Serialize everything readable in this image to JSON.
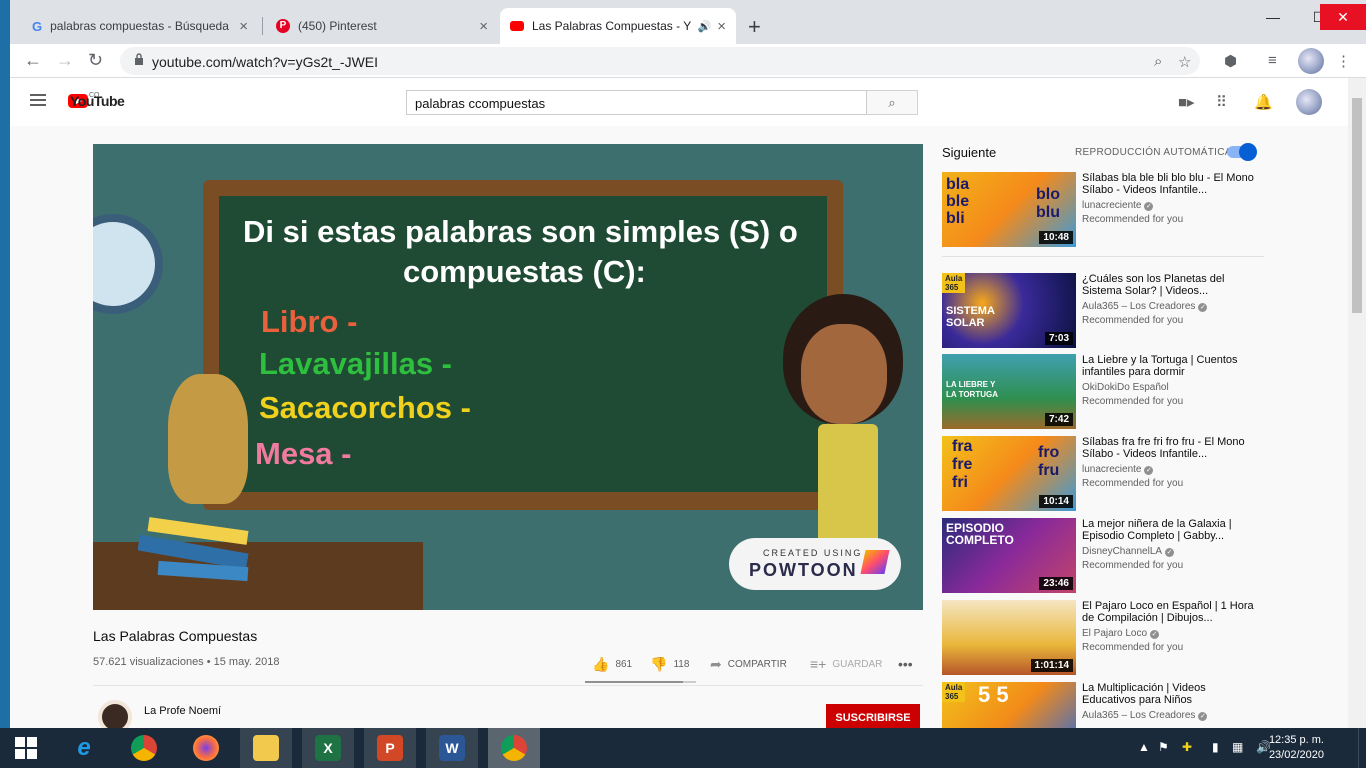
{
  "browser": {
    "tabs": [
      {
        "title": "palabras compuestas - Búsqueda",
        "icon": "google-icon"
      },
      {
        "title": "(450) Pinterest",
        "icon": "pinterest-icon"
      },
      {
        "title": "Las Palabras Compuestas - Y",
        "icon": "youtube-icon"
      }
    ],
    "url": "youtube.com/watch?v=yGs2t_-JWEI"
  },
  "header": {
    "logo_text": "YouTube",
    "region": "CO",
    "search_query": "palabras ccompuestas"
  },
  "video": {
    "slide_question_line1": "Di si estas palabras son simples (S) o",
    "slide_question_line2": "compuestas (C):",
    "slide_words": [
      {
        "text": "Libro -",
        "color": "#e8603c"
      },
      {
        "text": "Lavavajillas -",
        "color": "#2fbf3f"
      },
      {
        "text": "Sacacorchos -",
        "color": "#f0d21e"
      },
      {
        "text": "Mesa -",
        "color": "#f07aa0"
      }
    ],
    "watermark_top": "CREATED USING",
    "watermark_brand": "POWTOON",
    "title": "Las Palabras Compuestas",
    "views": "57.621 visualizaciones • 15 may. 2018",
    "likes": "861",
    "dislikes": "118",
    "like_ratio": 0.88,
    "share_label": "COMPARTIR",
    "save_label": "GUARDAR",
    "channel": "La Profe Noemí",
    "subscribe_label": "SUSCRIBIRSE"
  },
  "sidebar": {
    "next_label": "Siguiente",
    "autoplay_label": "REPRODUCCIÓN AUTOMÁTICA",
    "autoplay_on": true,
    "items": [
      {
        "title": "Sílabas bla ble bli blo blu - El Mono Sílabo - Videos Infantile...",
        "channel": "lunacreciente",
        "note": "Recommended for you",
        "duration": "10:48",
        "thumb_color": "#f2b21a"
      },
      {
        "title": "¿Cuáles son los Planetas del Sistema Solar? | Videos...",
        "channel": "Aula365 – Los Creadores",
        "note": "Recommended for you",
        "duration": "7:03",
        "thumb_color": "#1a2a7a"
      },
      {
        "title": "La Liebre y la Tortuga | Cuentos infantiles para dormir",
        "channel": "OkiDokiDo Español",
        "note": "Recommended for you",
        "duration": "7:42",
        "thumb_color": "#2f8f4f"
      },
      {
        "title": "Sílabas fra fre fri fro fru - El Mono Sílabo - Videos Infantile...",
        "channel": "lunacreciente",
        "note": "Recommended for you",
        "duration": "10:14",
        "thumb_color": "#f2c21a"
      },
      {
        "title": "La mejor niñera de la Galaxia | Episodio Completo | Gabby...",
        "channel": "DisneyChannelLA",
        "note": "Recommended for you",
        "duration": "23:46",
        "thumb_color": "#6a2a8a"
      },
      {
        "title": "El Pajaro Loco en Español | 1 Hora de Compilación | Dibujos...",
        "channel": "El Pajaro Loco",
        "note": "Recommended for you",
        "duration": "1:01:14",
        "thumb_color": "#e9b63a"
      },
      {
        "title": "La Multiplicación | Videos Educativos para Niños",
        "channel": "Aula365 – Los Creadores",
        "note": "",
        "duration": "",
        "thumb_color": "#f28a1a"
      }
    ]
  },
  "taskbar": {
    "time": "12:35 p. m.",
    "date": "23/02/2020",
    "apps": [
      "start-icon",
      "ie-icon",
      "chrome-icon",
      "firefox-icon",
      "explorer-icon",
      "excel-icon",
      "powerpoint-icon",
      "word-icon",
      "chrome-icon"
    ]
  }
}
